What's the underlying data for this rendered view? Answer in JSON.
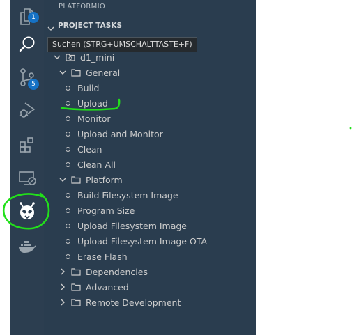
{
  "colors": {
    "activity_bar": "#2c3e50",
    "sidebar": "#2a3d4f",
    "badge": "#1672c5",
    "annotation": "#22e01a"
  },
  "activity_bar": {
    "items": [
      {
        "icon": "explorer-icon",
        "badge": "1"
      },
      {
        "icon": "search-icon"
      },
      {
        "icon": "source-control-icon",
        "badge": "5"
      },
      {
        "icon": "run-debug-icon"
      },
      {
        "icon": "extensions-icon"
      },
      {
        "icon": "remote-explorer-icon"
      },
      {
        "icon": "platformio-icon"
      },
      {
        "icon": "docker-icon"
      }
    ]
  },
  "sidebar": {
    "title": "PLATFORMIO",
    "section": "PROJECT TASKS",
    "env": "d1_mini",
    "general": {
      "label": "General",
      "tasks": [
        "Build",
        "Upload",
        "Monitor",
        "Upload and Monitor",
        "Clean",
        "Clean All"
      ]
    },
    "platform": {
      "label": "Platform",
      "tasks": [
        "Build Filesystem Image",
        "Program Size",
        "Upload Filesystem Image",
        "Upload Filesystem Image OTA",
        "Erase Flash"
      ]
    },
    "collapsed": [
      "Dependencies",
      "Advanced",
      "Remote Development"
    ]
  },
  "tooltip": "Suchen (STRG+UMSCHALTTASTE+F)"
}
